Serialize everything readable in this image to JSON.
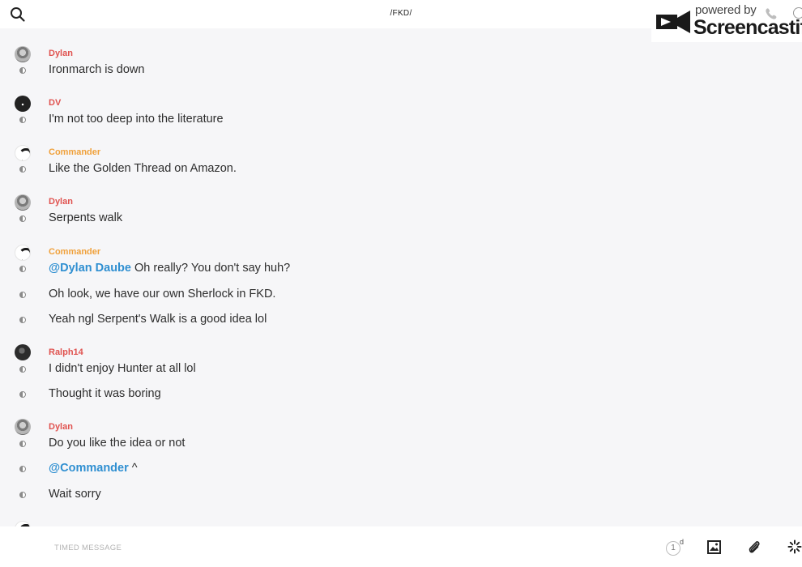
{
  "header": {
    "channel_title": "/FKD/",
    "search_icon": "search-icon"
  },
  "watermark": {
    "powered_text": "powered by",
    "brand_text": "Screencastify",
    "icons": [
      "screencastify-logo-icon",
      "phone-icon",
      "info-icon"
    ]
  },
  "messages": [
    {
      "author": "Dylan",
      "name_color": "#e0524f",
      "avatar": "dylan",
      "lines": [
        {
          "text": "Ironmarch is down"
        }
      ]
    },
    {
      "author": "DV",
      "name_color": "#e0524f",
      "avatar": "dv",
      "lines": [
        {
          "text": "I'm not too deep into the literature"
        }
      ]
    },
    {
      "author": "Commander",
      "name_color": "#f0a13b",
      "avatar": "commander",
      "lines": [
        {
          "text": "Like the Golden Thread on Amazon."
        }
      ]
    },
    {
      "author": "Dylan",
      "name_color": "#e0524f",
      "avatar": "dylan",
      "lines": [
        {
          "text": "Serpents walk"
        }
      ]
    },
    {
      "author": "Commander",
      "name_color": "#f0a13b",
      "avatar": "commander",
      "lines": [
        {
          "mention": "@Dylan Daube",
          "text": " Oh really? You don't say huh?"
        },
        {
          "text": "Oh look, we have our own Sherlock in FKD."
        },
        {
          "text": "Yeah ngl Serpent's Walk is a good idea lol"
        }
      ]
    },
    {
      "author": "Ralph14",
      "name_color": "#e0524f",
      "avatar": "ralph",
      "lines": [
        {
          "text": "I didn't enjoy Hunter at all lol"
        },
        {
          "text": "Thought it was boring"
        }
      ]
    },
    {
      "author": "Dylan",
      "name_color": "#e0524f",
      "avatar": "dylan",
      "lines": [
        {
          "text": "Do you like the idea or not"
        },
        {
          "mention": "@Commander",
          "text": " ^"
        },
        {
          "text": "Wait sorry"
        }
      ]
    }
  ],
  "composer": {
    "placeholder": "TIMED MESSAGE",
    "timer_value": "1",
    "timer_unit": "d",
    "icons": [
      "timer-icon",
      "image-icon",
      "paperclip-icon",
      "sparkle-icon"
    ]
  },
  "colors": {
    "background": "#f6f6f8",
    "name_red": "#e0524f",
    "name_orange": "#f0a13b",
    "mention_blue": "#2f8fd1"
  }
}
